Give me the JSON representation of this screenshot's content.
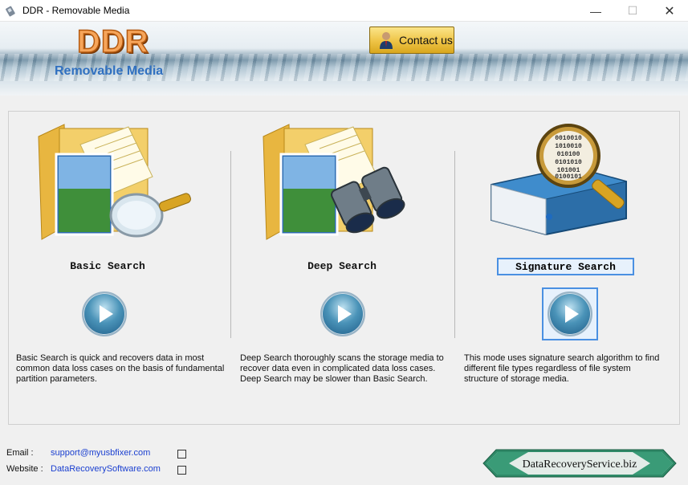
{
  "window": {
    "title": "DDR - Removable Media"
  },
  "header": {
    "logo": "DDR",
    "subtitle": "Removable Media",
    "contact_label": "Contact us"
  },
  "modes": [
    {
      "title": "Basic Search",
      "description_lines": [
        "Basic Search is quick and recovers data in most",
        "common data loss cases on the basis of fundamental",
        "partition parameters."
      ]
    },
    {
      "title": "Deep Search",
      "description_lines": [
        "Deep Search thoroughly scans the storage media to",
        "recover data even in complicated data loss cases.",
        "Deep Search may be slower than Basic Search."
      ]
    },
    {
      "title": "Signature Search",
      "description_lines": [
        "This mode uses signature search algorithm to find",
        "different file types regardless of file system",
        "structure of storage media."
      ],
      "selected": true
    }
  ],
  "footer": {
    "email_label": "Email :",
    "email": "support@myusbfixer.com",
    "website_label": "Website :",
    "website": "DataRecoverySoftware.com",
    "badge": "DataRecoveryService.biz"
  },
  "magnifier_binary": [
    "0010010",
    "1010010",
    "010100",
    "0101010",
    "101001",
    "0100101"
  ],
  "colors": {
    "accent": "#4a90e2",
    "logo": "#f6a55a",
    "subtitle": "#3070c0",
    "link": "#1a3fd0"
  }
}
